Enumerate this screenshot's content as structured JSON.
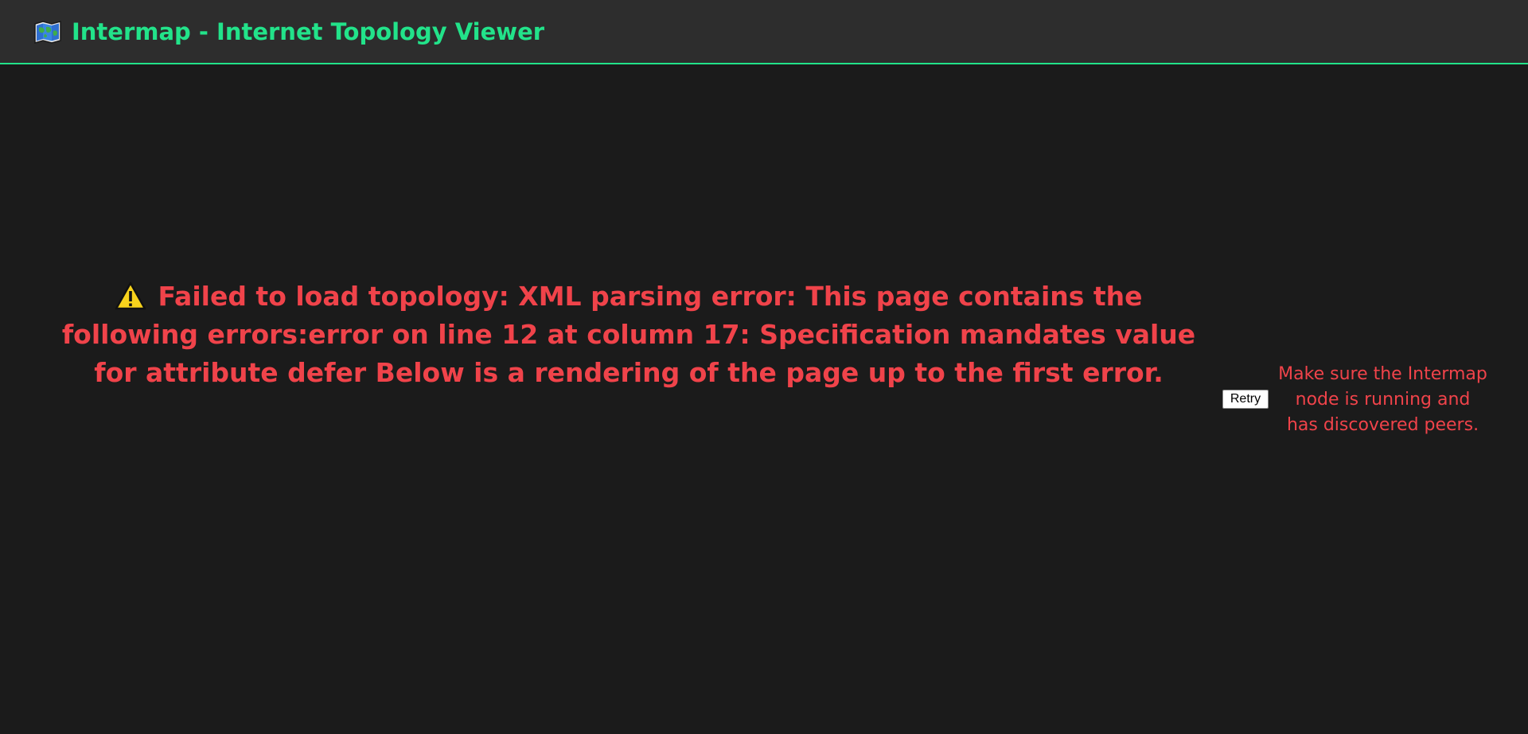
{
  "header": {
    "title": "Intermap - Internet Topology Viewer",
    "icon": "world-map-icon",
    "accent_color": "#22e38a"
  },
  "error": {
    "icon": "warning-icon",
    "message": "Failed to load topology: XML parsing error: This page contains the following errors:error on line 12 at column 17: Specification mandates value for attribute defer Below is a rendering of the page up to the first error.",
    "color": "#f0434a"
  },
  "retry": {
    "label": "Retry"
  },
  "hint": {
    "text": "Make sure the Intermap node is running and has discovered peers."
  }
}
